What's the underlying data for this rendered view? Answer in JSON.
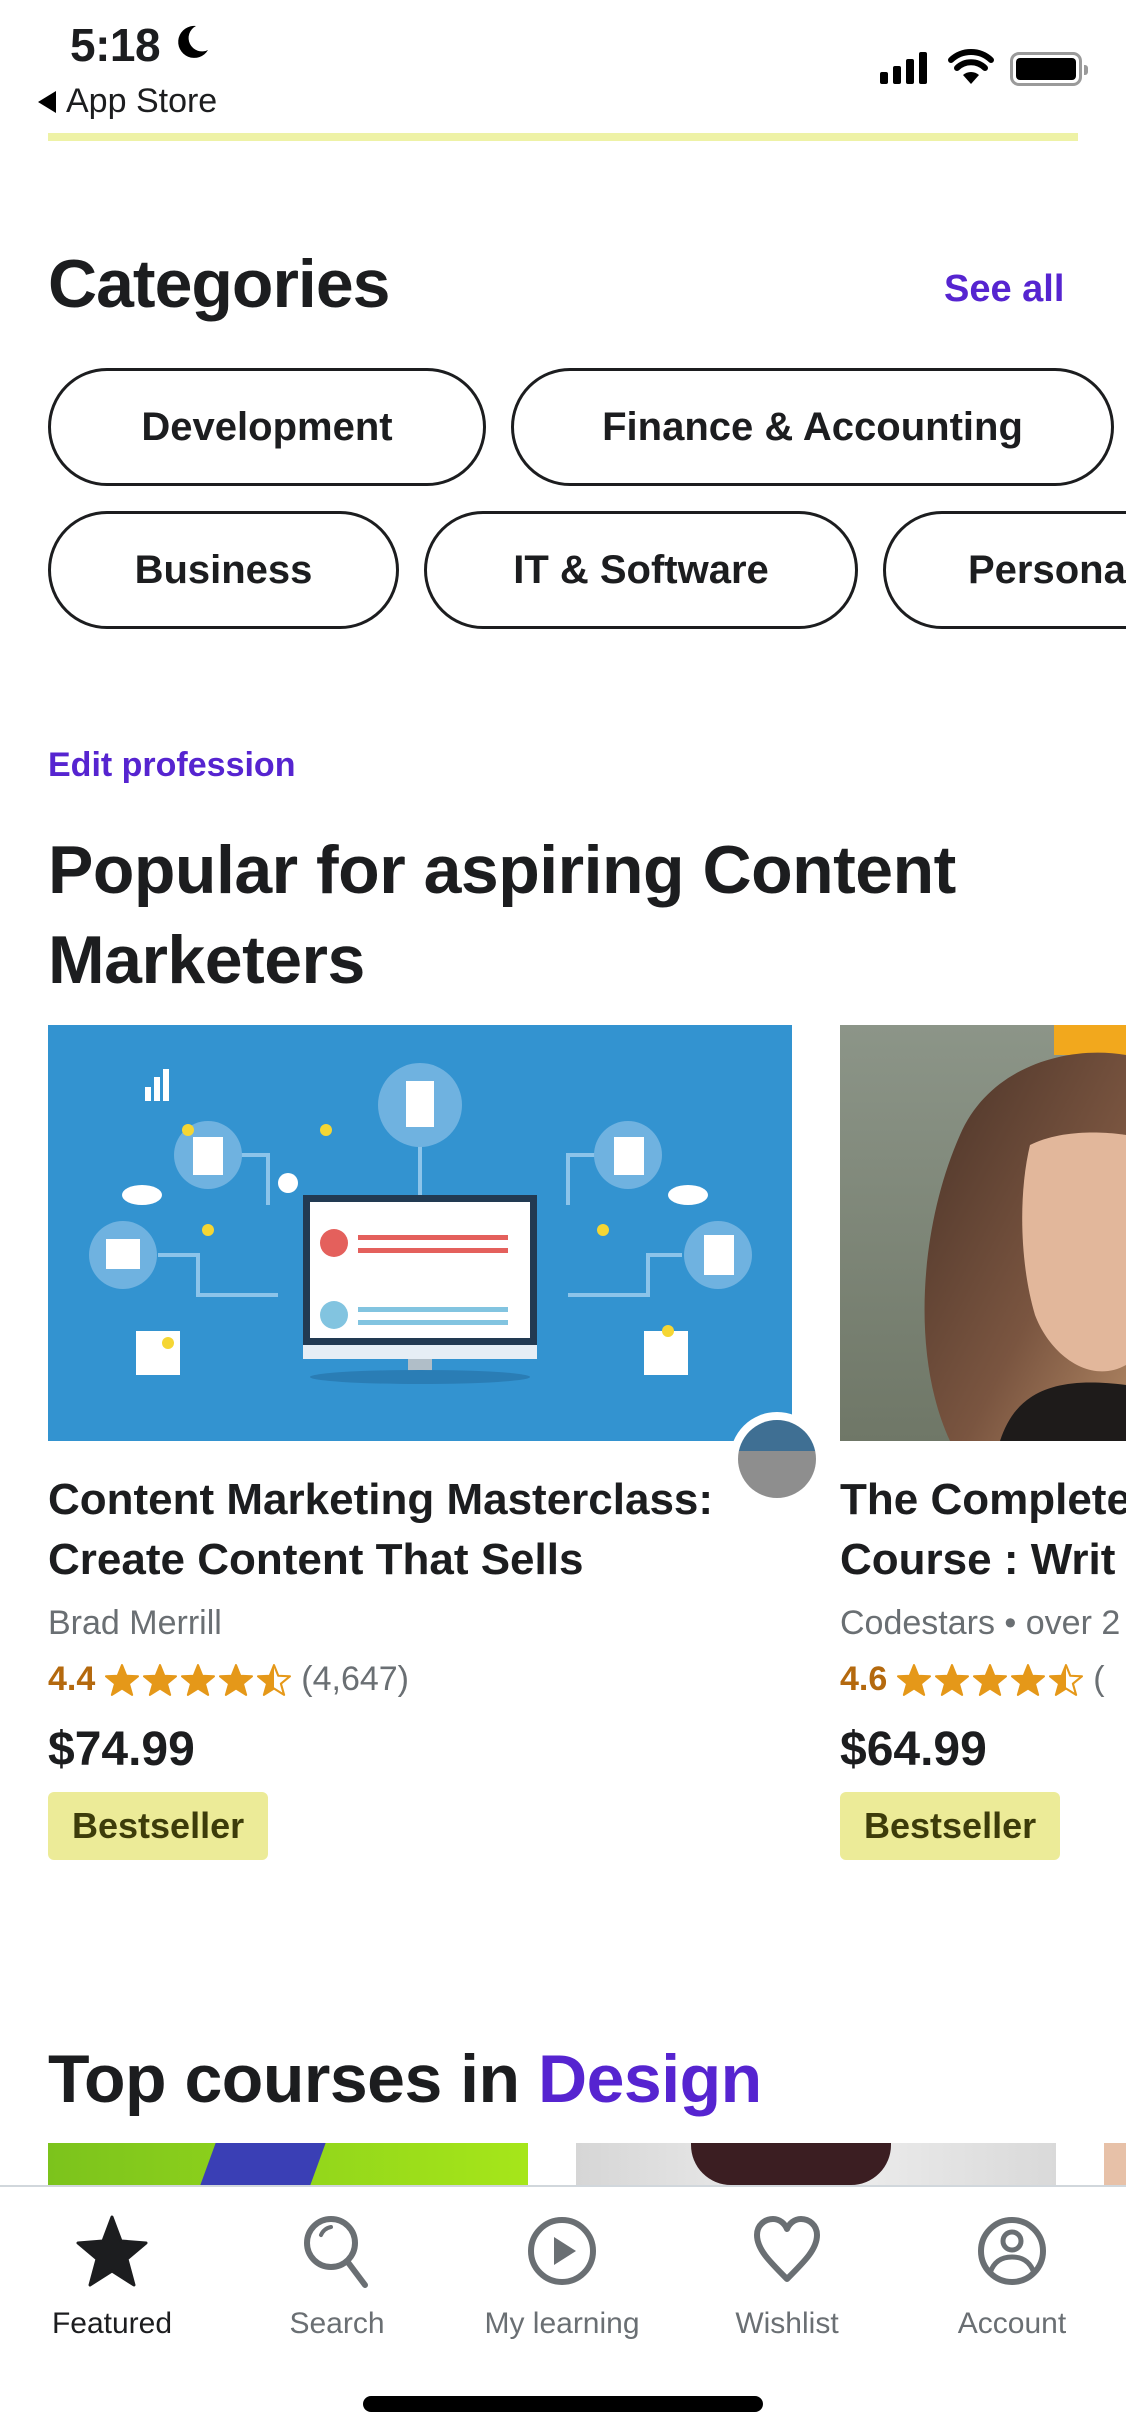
{
  "status_bar": {
    "time": "5:18",
    "back_label": "App Store",
    "icons": [
      "moon-icon",
      "signal-icon",
      "wifi-icon",
      "battery-icon"
    ]
  },
  "categories": {
    "heading": "Categories",
    "see_all": "See all",
    "row1": [
      "Development",
      "Finance & Accounting"
    ],
    "row2": [
      "Business",
      "IT & Software",
      "Personal Development"
    ]
  },
  "popular": {
    "edit_profession": "Edit profession",
    "heading": "Popular for aspiring Content Marketers",
    "courses": [
      {
        "title_line1": "Content Marketing Masterclass:",
        "title_line2": "Create Content That Sells",
        "author": "Brad Merrill",
        "rating": "4.4",
        "rating_value": 4.4,
        "rating_count": "(4,647)",
        "price": "$74.99",
        "badge": "Bestseller"
      },
      {
        "title_line1": "The Complete",
        "title_line2": "Course : Writ",
        "author": "Codestars • over 2",
        "rating": "4.6",
        "rating_value": 4.6,
        "rating_count": "(",
        "price": "$64.99",
        "badge": "Bestseller"
      }
    ]
  },
  "top_courses": {
    "heading_prefix": "Top courses in ",
    "heading_accent": "Design"
  },
  "tab_bar": {
    "tabs": [
      {
        "label": "Featured",
        "icon": "star-icon",
        "active": true
      },
      {
        "label": "Search",
        "icon": "search-icon",
        "active": false
      },
      {
        "label": "My learning",
        "icon": "play-circle-icon",
        "active": false
      },
      {
        "label": "Wishlist",
        "icon": "heart-icon",
        "active": false
      },
      {
        "label": "Account",
        "icon": "account-icon",
        "active": false
      }
    ]
  },
  "colors": {
    "brand_purple": "#5624d0",
    "rating_orange": "#b4690e",
    "star_fill": "#e59819",
    "badge_bg": "#eceb98",
    "progress_line": "#eef2a6"
  }
}
